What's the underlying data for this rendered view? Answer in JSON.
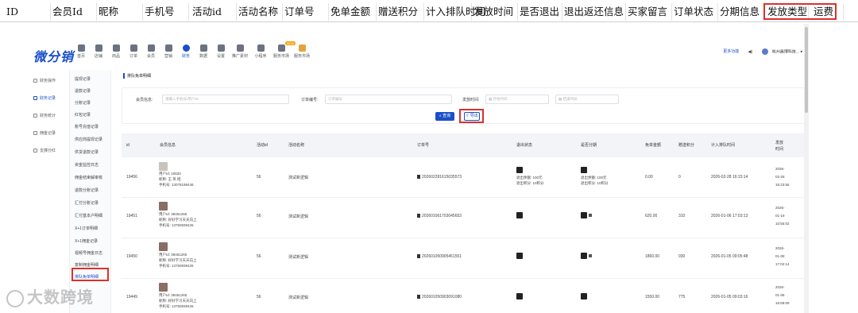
{
  "sheet": {
    "headers": [
      "ID",
      "会员Id",
      "昵称",
      "手机号",
      "活动id",
      "活动名称",
      "订单号",
      "免单金额",
      "赠送积分",
      "计入排队时间",
      "发放时间",
      "是否退出",
      "退出返还信息",
      "买家留言",
      "订单状态",
      "分期信息",
      "发放类型",
      "运费"
    ]
  },
  "app": {
    "logo": "微分销",
    "nav": [
      "首页",
      "店铺",
      "商品",
      "订单",
      "会员",
      "营销",
      "财务",
      "数据",
      "设置",
      "推广素材",
      "小程序",
      "服务市场",
      "服务市场"
    ],
    "nav_badge": "NEW",
    "header_right": {
      "tag": "更多功能",
      "shop": "杭州昌博科技..."
    }
  },
  "side1": [
    "财务操作",
    "财务记录",
    "财务统计",
    "佣金记录",
    "支撑分红"
  ],
  "side2": [
    "提现记录",
    "退款记录",
    "分账记录",
    "红包记录",
    "账号充值记录",
    "供应商提现记录",
    "供货退款记录",
    "资金监控日志",
    "佣金结束解审核",
    "退款分账记录",
    "汇付分账记录",
    "汇付基本户明细",
    "X+1订单明细",
    "X+1佣金记录",
    "视频号佣金日志",
    "复制佣金明细",
    "排队免单明细"
  ],
  "main": {
    "title": "排队免单明细",
    "filters": {
      "member_label": "会员信息:",
      "member_placeholder": "请输入手机号/用户ID",
      "order_label": "订单编号:",
      "order_placeholder": "订单编号",
      "time_label": "发放时间:",
      "start_placeholder": "开始时间",
      "end_placeholder": "结束时间"
    },
    "search_label": "查询",
    "export_label": "导出",
    "columns": [
      "id",
      "会员信息",
      "活动id",
      "活动名称",
      "订单号",
      "退出状态",
      "是否分期",
      "免单金额",
      "赠送积分",
      "计入排队时间",
      "发放时间"
    ],
    "rows": [
      {
        "id": "19456",
        "uid": "用户Id: 10820",
        "nick": "昵称: 王 英 旭",
        "phone": "手机号: 13076198446",
        "act_id": "56",
        "act_name": "测试新逻辑",
        "order": "202602281615035573",
        "exit_a": "退出余额: 100元",
        "exit_b": "退出积分: 10积分",
        "inst_a": "退出余额: 100元",
        "inst_b": "退出积分: 10积分",
        "amount": "0.00",
        "points": "0",
        "queue_time": "2026-02-28 16:15:14",
        "grant_time": [
          "2026-",
          "02-28",
          "16:23:56"
        ]
      },
      {
        "id": "19451",
        "uid": "用户Id: 38461265",
        "nick": "昵称: 好好学习天天向上",
        "phone": "手机号: 13750839426",
        "act_id": "56",
        "act_name": "测试新逻辑",
        "order": "202601061703045653",
        "exit_a": "",
        "exit_b": "",
        "inst_a": "",
        "inst_b": "",
        "amount": "620.00",
        "points": "310",
        "queue_time": "2026-01-06 17:03:13",
        "grant_time": [
          "2026-",
          "01-19",
          "10:55:02"
        ]
      },
      {
        "id": "19450",
        "uid": "用户Id: 38461265",
        "nick": "昵称: 好好学习天天向上",
        "phone": "手机号: 13750839426",
        "act_id": "56",
        "act_name": "测试新逻辑",
        "order": "202601050905451551",
        "exit_a": "",
        "exit_b": "",
        "inst_a": "",
        "inst_b": "",
        "amount": "1860.00",
        "points": "930",
        "queue_time": "2026-01-05 09:05:48",
        "grant_time": [
          "2026-",
          "01-08",
          "17:02:14"
        ]
      },
      {
        "id": "19449",
        "uid": "用户Id: 38461265",
        "nick": "昵称: 好好学习天天向上",
        "phone": "手机号: 13750839426",
        "act_id": "56",
        "act_name": "测试新逻辑",
        "order": "202601050903091080",
        "exit_a": "",
        "exit_b": "",
        "inst_a": "",
        "inst_b": "",
        "amount": "1550.00",
        "points": "775",
        "queue_time": "2026-01-05 09:03:16",
        "grant_time": [
          "2026-",
          "01-08",
          "16:59:09"
        ]
      }
    ]
  },
  "watermark": "大数跨境",
  "colors": {
    "accent": "#1a4fc9",
    "highlight": "#d9332b"
  }
}
